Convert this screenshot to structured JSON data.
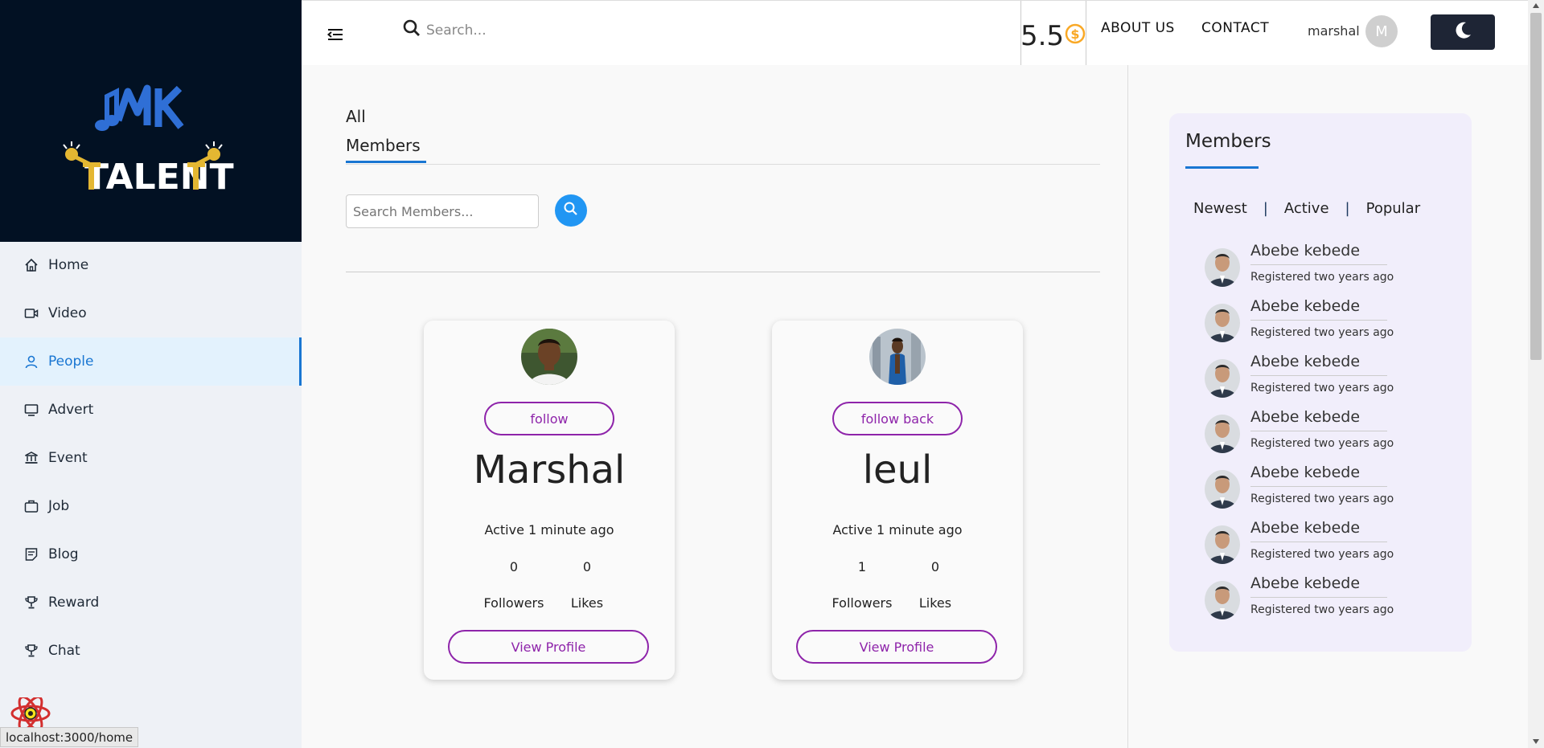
{
  "sidebar": {
    "brand": "MK TALENT",
    "items": [
      {
        "label": "Home",
        "icon": "home-icon"
      },
      {
        "label": "Video",
        "icon": "video-icon"
      },
      {
        "label": "People",
        "icon": "person-icon",
        "active": true
      },
      {
        "label": "Advert",
        "icon": "monitor-icon"
      },
      {
        "label": "Event",
        "icon": "bank-icon"
      },
      {
        "label": "Job",
        "icon": "briefcase-icon"
      },
      {
        "label": "Blog",
        "icon": "blog-icon"
      },
      {
        "label": "Reward",
        "icon": "trophy-icon"
      },
      {
        "label": "Chat",
        "icon": "trophy-icon"
      }
    ],
    "status_url": "localhost:3000/home"
  },
  "topbar": {
    "search_placeholder": "Search...",
    "balance": "5.5",
    "about": "ABOUT US",
    "contact": "CONTACT",
    "username": "marshal",
    "avatar_letter": "M"
  },
  "main": {
    "title_all": "All",
    "title_members": "Members",
    "search_placeholder": "Search Members...",
    "cards": [
      {
        "name": "Marshal",
        "follow_label": "follow",
        "active": "Active 1 minute ago",
        "followers": "0",
        "likes": "0",
        "followers_label": "Followers",
        "likes_label": "Likes",
        "view_label": "View Profile"
      },
      {
        "name": "leul",
        "follow_label": "follow back",
        "active": "Active 1 minute ago",
        "followers": "1",
        "likes": "0",
        "followers_label": "Followers",
        "likes_label": "Likes",
        "view_label": "View Profile"
      }
    ]
  },
  "panel": {
    "title": "Members",
    "tabs": [
      "Newest",
      "Active",
      "Popular"
    ],
    "separator": "|",
    "members": [
      {
        "name": "Abebe kebede",
        "sub": "Registered two years ago"
      },
      {
        "name": "Abebe kebede",
        "sub": "Registered two years ago"
      },
      {
        "name": "Abebe kebede",
        "sub": "Registered two years ago"
      },
      {
        "name": "Abebe kebede",
        "sub": "Registered two years ago"
      },
      {
        "name": "Abebe kebede",
        "sub": "Registered two years ago"
      },
      {
        "name": "Abebe kebede",
        "sub": "Registered two years ago"
      },
      {
        "name": "Abebe kebede",
        "sub": "Registered two years ago"
      }
    ]
  },
  "colors": {
    "accent": "#1976d2",
    "purple": "#8e24aa",
    "sidebar_dark": "#021123",
    "gold": "#f9a825"
  }
}
